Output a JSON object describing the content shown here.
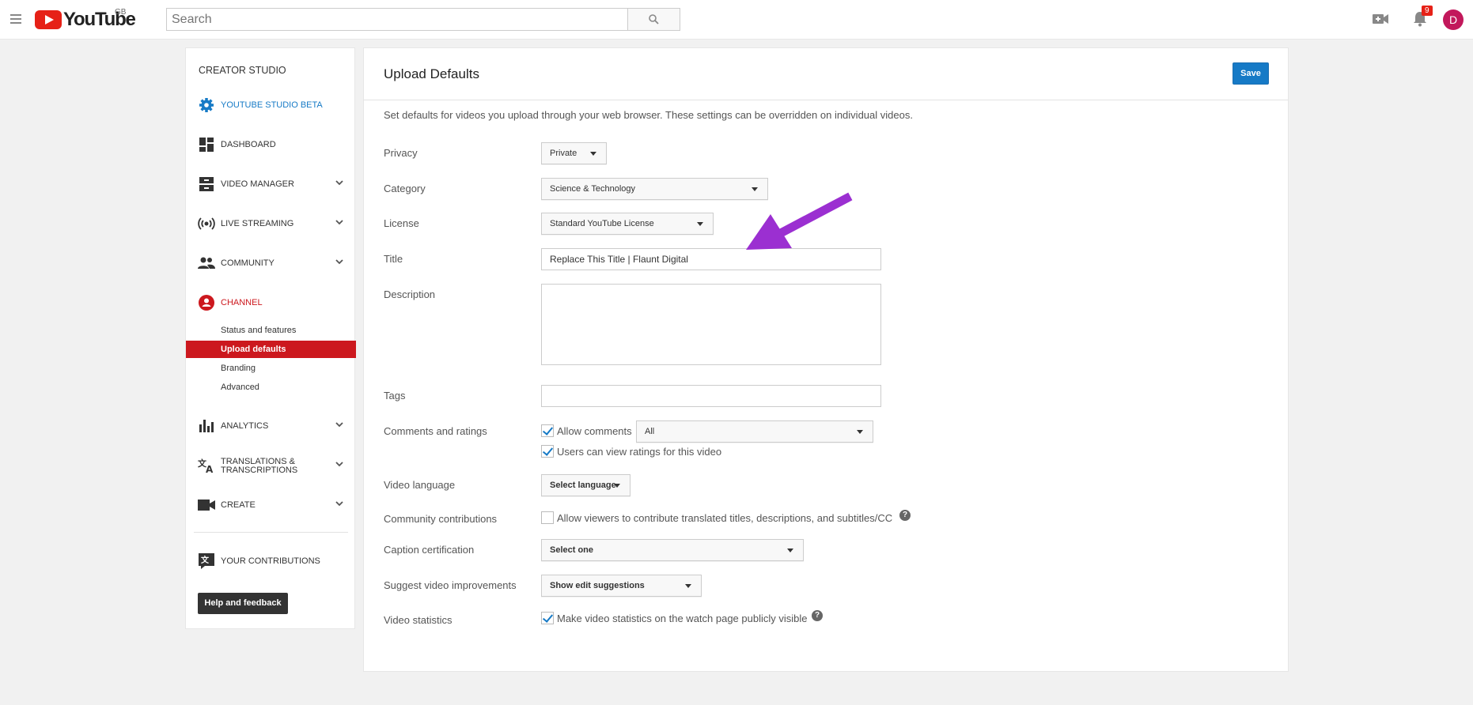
{
  "topbar": {
    "logo_text": "YouTube",
    "region": "GB",
    "search_placeholder": "Search",
    "notification_count": "9",
    "avatar_letter": "D"
  },
  "sidebar": {
    "heading": "CREATOR STUDIO",
    "items": [
      {
        "label": "YOUTUBE STUDIO BETA",
        "icon": "gear-icon",
        "color": "#167ac6"
      },
      {
        "label": "DASHBOARD",
        "icon": "dashboard-icon"
      },
      {
        "label": "VIDEO MANAGER",
        "icon": "video-manager-icon",
        "expandable": true
      },
      {
        "label": "LIVE STREAMING",
        "icon": "live-streaming-icon",
        "expandable": true
      },
      {
        "label": "COMMUNITY",
        "icon": "community-icon",
        "expandable": true
      },
      {
        "label": "CHANNEL",
        "icon": "channel-icon",
        "color": "#cc181e"
      },
      {
        "label": "ANALYTICS",
        "icon": "analytics-icon",
        "expandable": true
      },
      {
        "label": "TRANSLATIONS &",
        "label2": "TRANSCRIPTIONS",
        "icon": "translate-icon",
        "expandable": true
      },
      {
        "label": "CREATE",
        "icon": "create-icon",
        "expandable": true
      },
      {
        "label": "YOUR CONTRIBUTIONS",
        "icon": "contributions-icon"
      }
    ],
    "channel_subitems": [
      "Status and features",
      "Upload defaults",
      "Branding",
      "Advanced"
    ],
    "active_subitem": "Upload defaults",
    "help_button": "Help and feedback"
  },
  "main": {
    "title": "Upload Defaults",
    "save_label": "Save",
    "intro": "Set defaults for videos you upload through your web browser. These settings can be overridden on individual videos.",
    "labels": {
      "privacy": "Privacy",
      "category": "Category",
      "license": "License",
      "title": "Title",
      "description": "Description",
      "tags": "Tags",
      "comments": "Comments and ratings",
      "video_language": "Video language",
      "community": "Community contributions",
      "caption": "Caption certification",
      "suggest": "Suggest video improvements",
      "statistics": "Video statistics"
    },
    "values": {
      "privacy": "Private",
      "category": "Science & Technology",
      "license": "Standard YouTube License",
      "title": "Replace This Title | Flaunt Digital",
      "description": "",
      "tags": "",
      "comments_filter": "All",
      "video_language": "Select language",
      "caption": "Select one",
      "suggest": "Show edit suggestions"
    },
    "checkboxes": {
      "allow_comments": {
        "label": "Allow comments",
        "checked": true
      },
      "view_ratings": {
        "label": "Users can view ratings for this video",
        "checked": true
      },
      "community": {
        "label": "Allow viewers to contribute translated titles, descriptions, and subtitles/CC",
        "checked": false
      },
      "statistics": {
        "label": "Make video statistics on the watch page publicly visible",
        "checked": true
      }
    },
    "annotation_arrow_color": "#9b2fd1"
  }
}
